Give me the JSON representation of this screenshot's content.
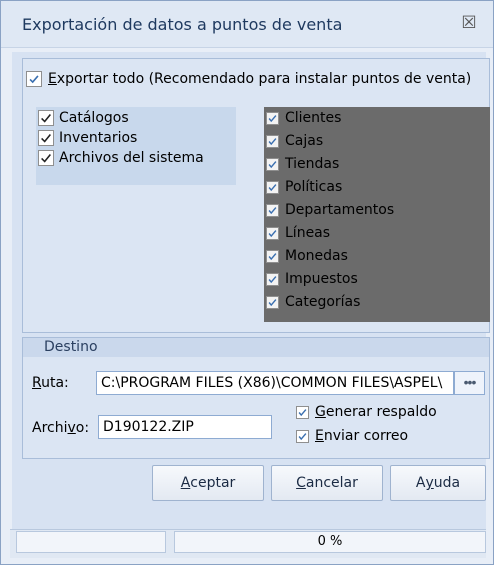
{
  "window": {
    "title": "Exportación de datos a puntos de venta",
    "close_symbol": "☒"
  },
  "export_all": {
    "label_prefix": "",
    "label_underlined": "E",
    "label_rest": "xportar todo (Recomendado para instalar puntos de venta)",
    "checked": true
  },
  "left_options": [
    {
      "label": "Catálogos",
      "checked": true
    },
    {
      "label": "Inventarios",
      "checked": true
    },
    {
      "label": "Archivos del sistema",
      "checked": true
    }
  ],
  "catalog_options": [
    {
      "label": "Clientes",
      "checked": true
    },
    {
      "label": "Cajas",
      "checked": true
    },
    {
      "label": "Tiendas",
      "checked": true
    },
    {
      "label": "Políticas",
      "checked": true
    },
    {
      "label": "Departamentos",
      "checked": true
    },
    {
      "label": "Líneas",
      "checked": true
    },
    {
      "label": "Monedas",
      "checked": true
    },
    {
      "label": "Impuestos",
      "checked": true
    },
    {
      "label": "Categorías",
      "checked": true
    }
  ],
  "destination": {
    "group_label": "Destino",
    "route_label_u": "R",
    "route_label_rest": "uta:",
    "route_value": "C:\\PROGRAM FILES (X86)\\COMMON FILES\\ASPEL\\",
    "browse_label": "•••",
    "file_label_pre": "Archi",
    "file_label_u": "v",
    "file_label_post": "o:",
    "file_value": "D190122.ZIP",
    "backup_u": "G",
    "backup_rest": "enerar respaldo",
    "backup_checked": true,
    "email_u": "E",
    "email_rest": "nviar correo",
    "email_checked": true
  },
  "buttons": {
    "accept_u": "A",
    "accept_rest": "ceptar",
    "cancel_u": "C",
    "cancel_rest": "ancelar",
    "help_pre": "A",
    "help_u": "y",
    "help_post": "uda"
  },
  "status": {
    "progress_text": "0 %",
    "progress_value": 0
  },
  "colors": {
    "window_bg": "#e8eef7",
    "dark_panel": "#6b6b6b",
    "check": "#3a6fb0"
  }
}
